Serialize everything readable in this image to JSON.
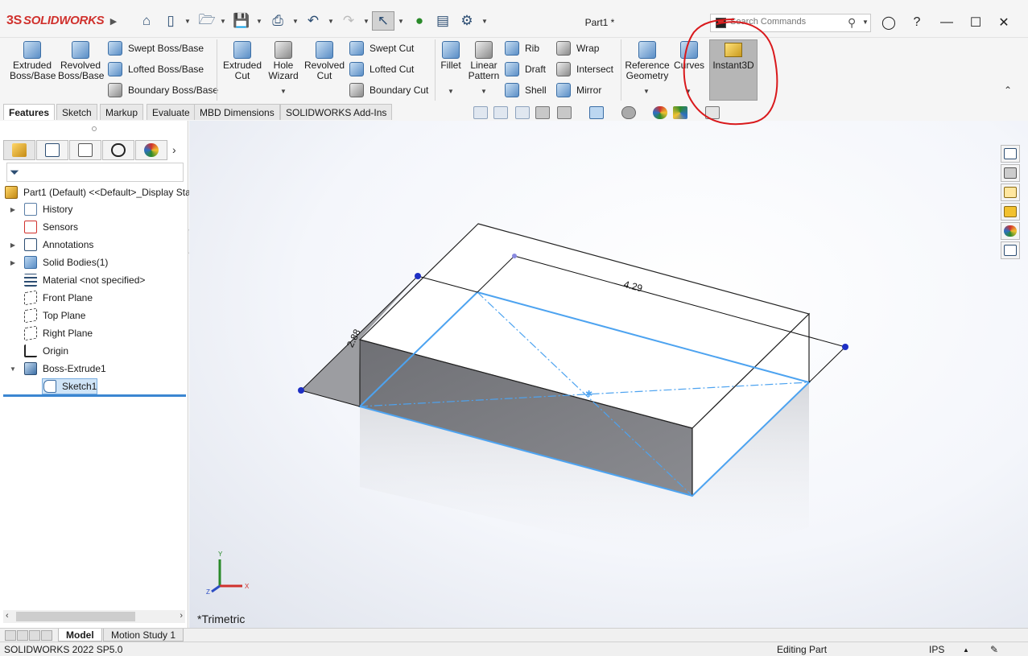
{
  "app": {
    "brand": "SOLIDWORKS",
    "doc_title": "Part1 *"
  },
  "search": {
    "placeholder": "Search Commands"
  },
  "ribbon": {
    "extruded_boss": "Extruded Boss/Base",
    "revolved_boss": "Revolved Boss/Base",
    "swept_boss": "Swept Boss/Base",
    "lofted_boss": "Lofted Boss/Base",
    "boundary_boss": "Boundary Boss/Base",
    "extruded_cut": "Extruded Cut",
    "hole_wizard": "Hole Wizard",
    "revolved_cut": "Revolved Cut",
    "swept_cut": "Swept Cut",
    "lofted_cut": "Lofted Cut",
    "boundary_cut": "Boundary Cut",
    "fillet": "Fillet",
    "linear_pattern": "Linear Pattern",
    "rib": "Rib",
    "draft": "Draft",
    "shell": "Shell",
    "wrap": "Wrap",
    "intersect": "Intersect",
    "mirror": "Mirror",
    "reference_geometry": "Reference Geometry",
    "curves": "Curves",
    "instant3d": "Instant3D"
  },
  "tabs": [
    "Features",
    "Sketch",
    "Markup",
    "Evaluate",
    "MBD Dimensions",
    "SOLIDWORKS Add-Ins"
  ],
  "tree": {
    "root": "Part1 (Default) <<Default>_Display Sta",
    "items": [
      "History",
      "Sensors",
      "Annotations",
      "Solid Bodies(1)",
      "Material <not specified>",
      "Front Plane",
      "Top Plane",
      "Right Plane",
      "Origin",
      "Boss-Extrude1",
      "Sketch1"
    ]
  },
  "viewport": {
    "dim_length": "4.29",
    "dim_width": "2.88",
    "view_orientation": "*Trimetric",
    "axis_labels": {
      "x": "X",
      "y": "Y",
      "z": "Z"
    },
    "sketch_color": "#4da3f0",
    "annotation_color": "#d9191c"
  },
  "bottom_tabs": [
    "Model",
    "Motion Study 1"
  ],
  "status": {
    "version": "SOLIDWORKS 2022 SP5.0",
    "mode": "Editing Part",
    "units": "IPS"
  }
}
